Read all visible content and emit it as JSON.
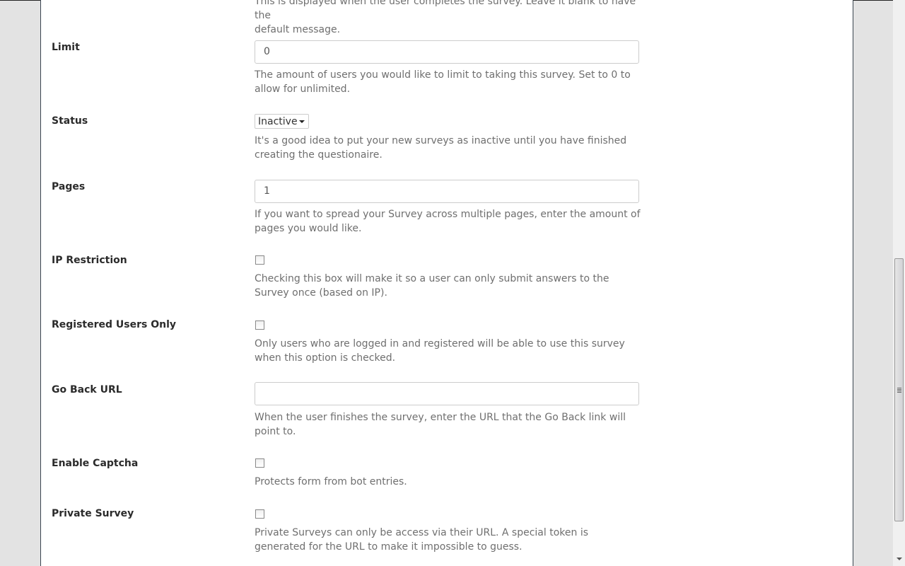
{
  "top_help": [
    "This is displayed when the user completes the survey. Leave it blank to have the",
    "default message."
  ],
  "fields": {
    "limit": {
      "label": "Limit",
      "value": "0",
      "help": "The amount of users you would like to limit to taking this survey. Set to 0 to allow for unlimited."
    },
    "status": {
      "label": "Status",
      "value": "Inactive",
      "help": "It's a good idea to put your new surveys as inactive until you have finished creating the questionaire."
    },
    "pages": {
      "label": "Pages",
      "value": "1",
      "help": "If you want to spread your Survey across multiple pages, enter the amount of pages you would like."
    },
    "ip": {
      "label": "IP Restriction",
      "checked": false,
      "help": "Checking this box will make it so a user can only submit answers to the Survey once (based on IP)."
    },
    "registered": {
      "label": "Registered Users Only",
      "checked": false,
      "help": "Only users who are logged in and registered will be able to use this survey when this option is checked."
    },
    "goback": {
      "label": "Go Back URL",
      "value": "",
      "help": "When the user finishes the survey, enter the URL that the Go Back link will point to."
    },
    "captcha": {
      "label": "Enable Captcha",
      "checked": false,
      "help": "Protects form from bot entries."
    },
    "private": {
      "label": "Private Survey",
      "checked": false,
      "help": "Private Surveys can only be access via their URL. A special token is generated for the URL to make it impossible to guess."
    }
  }
}
